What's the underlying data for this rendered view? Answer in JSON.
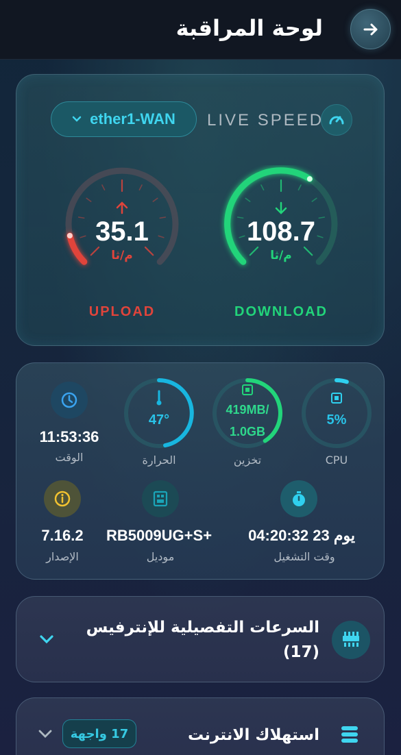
{
  "header": {
    "title": "لوحة المراقبة"
  },
  "speed": {
    "interface": "ether1-WAN",
    "live_label": "LIVE SPEED",
    "upload": {
      "value": "35.1",
      "unit": "م/ثا",
      "caption": "UPLOAD",
      "color": "#e0443b",
      "level": 0.12
    },
    "download": {
      "value": "108.7",
      "unit": "م/ثا",
      "caption": "DOWNLOAD",
      "color": "#22d47a",
      "level": 0.62
    }
  },
  "stats": {
    "time": {
      "value": "11:53:36",
      "label": "الوقت"
    },
    "temperature": {
      "value": "47°",
      "label": "الحرارة",
      "level": 0.47
    },
    "storage": {
      "used": "419MB/",
      "total": "1.0GB",
      "label": "تخزين",
      "level": 0.41
    },
    "cpu": {
      "value": "5%",
      "label": "CPU",
      "level": 0.05
    },
    "version": {
      "value": "7.16.2",
      "label": "الإصدار"
    },
    "model": {
      "value": "RB5009UG+S+",
      "label": "موديل"
    },
    "uptime": {
      "value": "04:20:32  23 يوم",
      "label": "وقت التشغيل"
    }
  },
  "sections": {
    "interface_speeds": {
      "title_line1": "السرعات التفصيلية للإنترفيس",
      "title_line2": "(17)"
    },
    "internet_usage": {
      "title": "استهلاك الانترنت",
      "badge": "17 واجهة"
    }
  },
  "colors": {
    "accent": "#3fd5ef",
    "upload": "#e0443b",
    "download": "#22d47a",
    "info": "#f2c230"
  }
}
